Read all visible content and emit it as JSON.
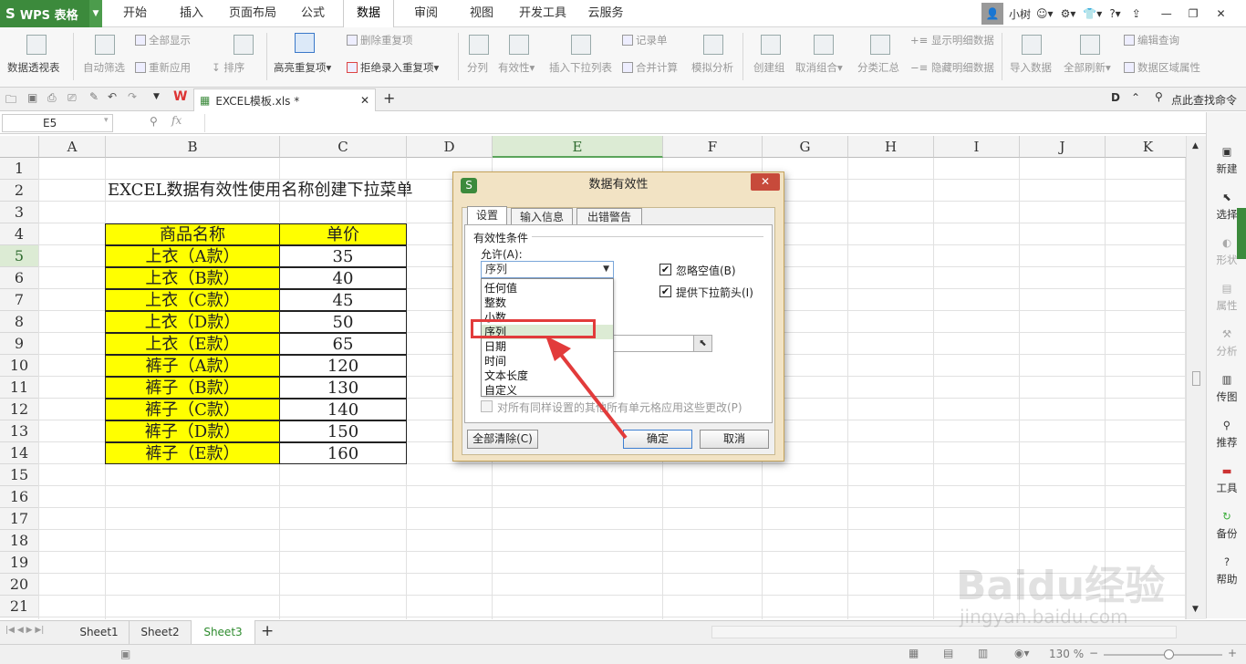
{
  "app": {
    "name": "WPS 表格"
  },
  "menu_tabs": [
    "开始",
    "插入",
    "页面布局",
    "公式",
    "数据",
    "审阅",
    "视图",
    "开发工具",
    "云服务"
  ],
  "active_tab": "数据",
  "user": {
    "name": "小树"
  },
  "ribbon": {
    "pivot": "数据透视表",
    "autofilter": "自动筛选",
    "show_all": "全部显示",
    "reapply": "重新应用",
    "sort": "排序",
    "highlight_dup": "高亮重复项",
    "remove_dup": "删除重复项",
    "reject_dup": "拒绝录入重复项",
    "split": "分列",
    "validity": "有效性",
    "insert_dropdown": "插入下拉列表",
    "record": "记录单",
    "merge_calc": "合并计算",
    "simulate": "模拟分析",
    "create_group": "创建组",
    "ungroup": "取消组合",
    "subtotal": "分类汇总",
    "show_detail": "显示明细数据",
    "hide_detail": "隐藏明细数据",
    "import": "导入数据",
    "refresh_all": "全部刷新",
    "edit_query": "编辑查询",
    "range_props": "数据区域属性"
  },
  "doc_tab": {
    "name": "EXCEL模板.xls *"
  },
  "search_cmd": "点此查找命令",
  "name_box": "E5",
  "fx": "fx",
  "columns": [
    "A",
    "B",
    "C",
    "D",
    "E",
    "F",
    "G",
    "H",
    "I",
    "J",
    "K"
  ],
  "rows": [
    "1",
    "2",
    "3",
    "4",
    "5",
    "6",
    "7",
    "8",
    "9",
    "10",
    "11",
    "12",
    "13",
    "14",
    "15",
    "16",
    "17",
    "18",
    "19",
    "20",
    "21"
  ],
  "sheet": {
    "title": "EXCEL数据有效性使用名称创建下拉菜单",
    "header": [
      "商品名称",
      "单价"
    ],
    "items": [
      {
        "name": "上衣（A款）",
        "price": "35"
      },
      {
        "name": "上衣（B款）",
        "price": "40"
      },
      {
        "name": "上衣（C款）",
        "price": "45"
      },
      {
        "name": "上衣（D款）",
        "price": "50"
      },
      {
        "name": "上衣（E款）",
        "price": "65"
      },
      {
        "name": "裤子（A款）",
        "price": "120"
      },
      {
        "name": "裤子（B款）",
        "price": "130"
      },
      {
        "name": "裤子（C款）",
        "price": "140"
      },
      {
        "name": "裤子（D款）",
        "price": "150"
      },
      {
        "name": "裤子（E款）",
        "price": "160"
      }
    ]
  },
  "right_sidebar": [
    "新建",
    "选择",
    "形状",
    "属性",
    "分析",
    "传图",
    "推荐",
    "工具",
    "备份",
    "帮助"
  ],
  "sheet_tabs": [
    "Sheet1",
    "Sheet2",
    "Sheet3"
  ],
  "active_sheet": "Sheet3",
  "zoom": "130 %",
  "dialog": {
    "title": "数据有效性",
    "tabs": [
      "设置",
      "输入信息",
      "出错警告"
    ],
    "group_label": "有效性条件",
    "allow_label": "允许(A):",
    "allow_value": "序列",
    "options": [
      "任何值",
      "整数",
      "小数",
      "序列",
      "日期",
      "时间",
      "文本长度",
      "自定义"
    ],
    "ignore_blank": "忽略空值(B)",
    "dropdown_arrow": "提供下拉箭头(I)",
    "apply_all": "对所有同样设置的其他所有单元格应用这些更改(P)",
    "clear_all": "全部清除(C)",
    "ok": "确定",
    "cancel": "取消"
  },
  "watermark": {
    "line1": "Baidu经验",
    "line2": "jingyan.baidu.com"
  },
  "colors": {
    "wps_green": "#3c8a3c",
    "highlight": "#ffff00",
    "annotation_red": "#e23b3b"
  }
}
